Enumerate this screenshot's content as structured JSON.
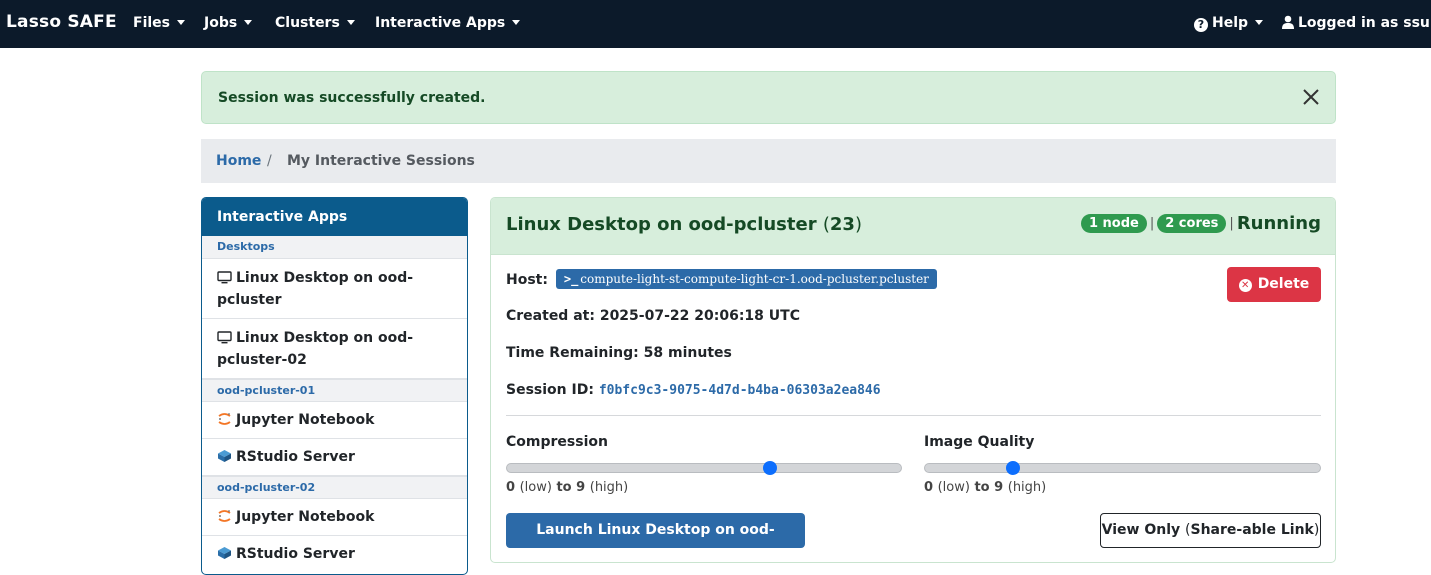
{
  "navbar": {
    "brand": "Lasso SAFE",
    "menus": [
      {
        "label": "Files"
      },
      {
        "label": "Jobs"
      },
      {
        "label": "Clusters"
      },
      {
        "label": "Interactive Apps"
      }
    ],
    "help_label": "Help",
    "user_label": "Logged in as ssun",
    "colors": {
      "background": "#0c1a2a"
    }
  },
  "alert": {
    "message": "Session was successfully created.",
    "close_icon": "close-icon"
  },
  "breadcrumb": {
    "home": "Home",
    "separator": "/",
    "current": "My Interactive Sessions"
  },
  "sidebar": {
    "title": "Interactive Apps",
    "groups": [
      {
        "label": "Desktops",
        "items": [
          {
            "label": "Linux Desktop on ood-pcluster",
            "icon": "monitor-icon"
          },
          {
            "label": "Linux Desktop on ood-pcluster-02",
            "icon": "monitor-icon"
          }
        ]
      },
      {
        "label": "ood-pcluster-01",
        "items": [
          {
            "label": "Jupyter Notebook",
            "icon": "jupyter-icon"
          },
          {
            "label": "RStudio Server",
            "icon": "rstudio-icon"
          }
        ]
      },
      {
        "label": "ood-pcluster-02",
        "items": [
          {
            "label": "Jupyter Notebook",
            "icon": "jupyter-icon"
          },
          {
            "label": "RStudio Server",
            "icon": "rstudio-icon"
          }
        ]
      }
    ]
  },
  "session": {
    "title": "Linux Desktop on ood-pcluster",
    "job_id": "23",
    "nodes_badge": "1 node",
    "cores_badge": "2 cores",
    "status": "Running",
    "host_label": "Host:",
    "host_value": "compute-light-st-compute-light-cr-1.ood-pcluster.pcluster",
    "created_label": "Created at:",
    "created_value": "2025-07-22 20:06:18 UTC",
    "remaining_label": "Time Remaining:",
    "remaining_value": "58 minutes",
    "session_id_label": "Session ID:",
    "session_id_value": "f0bfc9c3-9075-4d7d-b4ba-06303a2ea846",
    "delete_label": "Delete",
    "compression": {
      "label": "Compression",
      "min": 0,
      "max": 9,
      "value": 6,
      "range_low": "0",
      "range_low_word": "low",
      "range_to": "to",
      "range_high": "9",
      "range_high_word": "high"
    },
    "image_quality": {
      "label": "Image Quality",
      "min": 0,
      "max": 9,
      "value": 2,
      "range_low": "0",
      "range_low_word": "low",
      "range_to": "to",
      "range_high": "9",
      "range_high_word": "high"
    },
    "launch_label": "Launch Linux Desktop on ood-pcluster",
    "view_only_label": "View Only",
    "share_label": "Share-able Link",
    "colors": {
      "running": "#2f9a4f",
      "primary": "#2c6aa8",
      "danger": "#dc3545",
      "slider_thumb": "#0d6efd"
    }
  }
}
